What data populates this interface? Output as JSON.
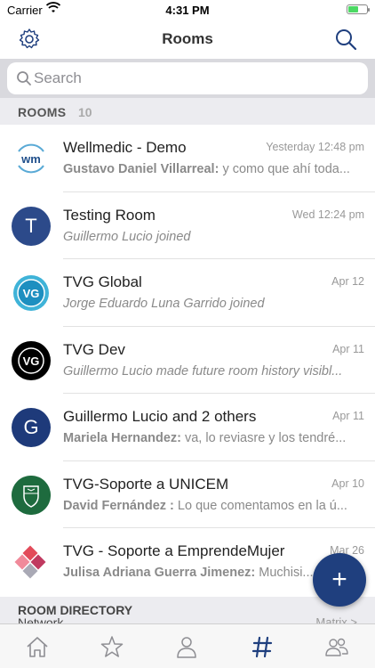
{
  "status_bar": {
    "carrier": "Carrier",
    "time": "4:31 PM",
    "battery_level": 0.55
  },
  "nav": {
    "title": "Rooms"
  },
  "search": {
    "placeholder": "Search"
  },
  "section": {
    "label": "ROOMS",
    "count": "10"
  },
  "rooms": [
    {
      "name": "Wellmedic - Demo",
      "date": "Yesterday 12:48 pm",
      "sender": "Gustavo Daniel Villarreal:",
      "message": " y como que ahí toda..."
    },
    {
      "name": "Testing Room",
      "date": "Wed 12:24 pm",
      "message": "Guillermo Lucio joined",
      "avatar_letter": "T"
    },
    {
      "name": "TVG Global",
      "date": "Apr 12",
      "message": "Jorge Eduardo Luna Garrido joined"
    },
    {
      "name": "TVG Dev",
      "date": "Apr 11",
      "message": "Guillermo Lucio made future room history visibl..."
    },
    {
      "name": "Guillermo Lucio and 2 others",
      "date": "Apr 11",
      "sender": "Mariela Hernandez:",
      "message": " va, lo reviasre y los tendré...",
      "avatar_letter": "G"
    },
    {
      "name": "TVG-Soporte a UNICEM",
      "date": "Apr 10",
      "sender": "David Fernández :",
      "message": " Lo que comentamos en la ú..."
    },
    {
      "name": "TVG - Soporte a EmprendeMujer",
      "date": "Mar 26",
      "sender": "Julisa Adriana Guerra Jimenez:",
      "message": " Muchisi..."
    }
  ],
  "directory": {
    "title": "ROOM DIRECTORY",
    "network_label": "Network",
    "network_value": "Matrix >"
  },
  "fab": {
    "label": "+"
  },
  "colors": {
    "accent": "#1f3f7e",
    "tab_active": "#1f3f7e",
    "tab_inactive": "#8e8e93"
  }
}
